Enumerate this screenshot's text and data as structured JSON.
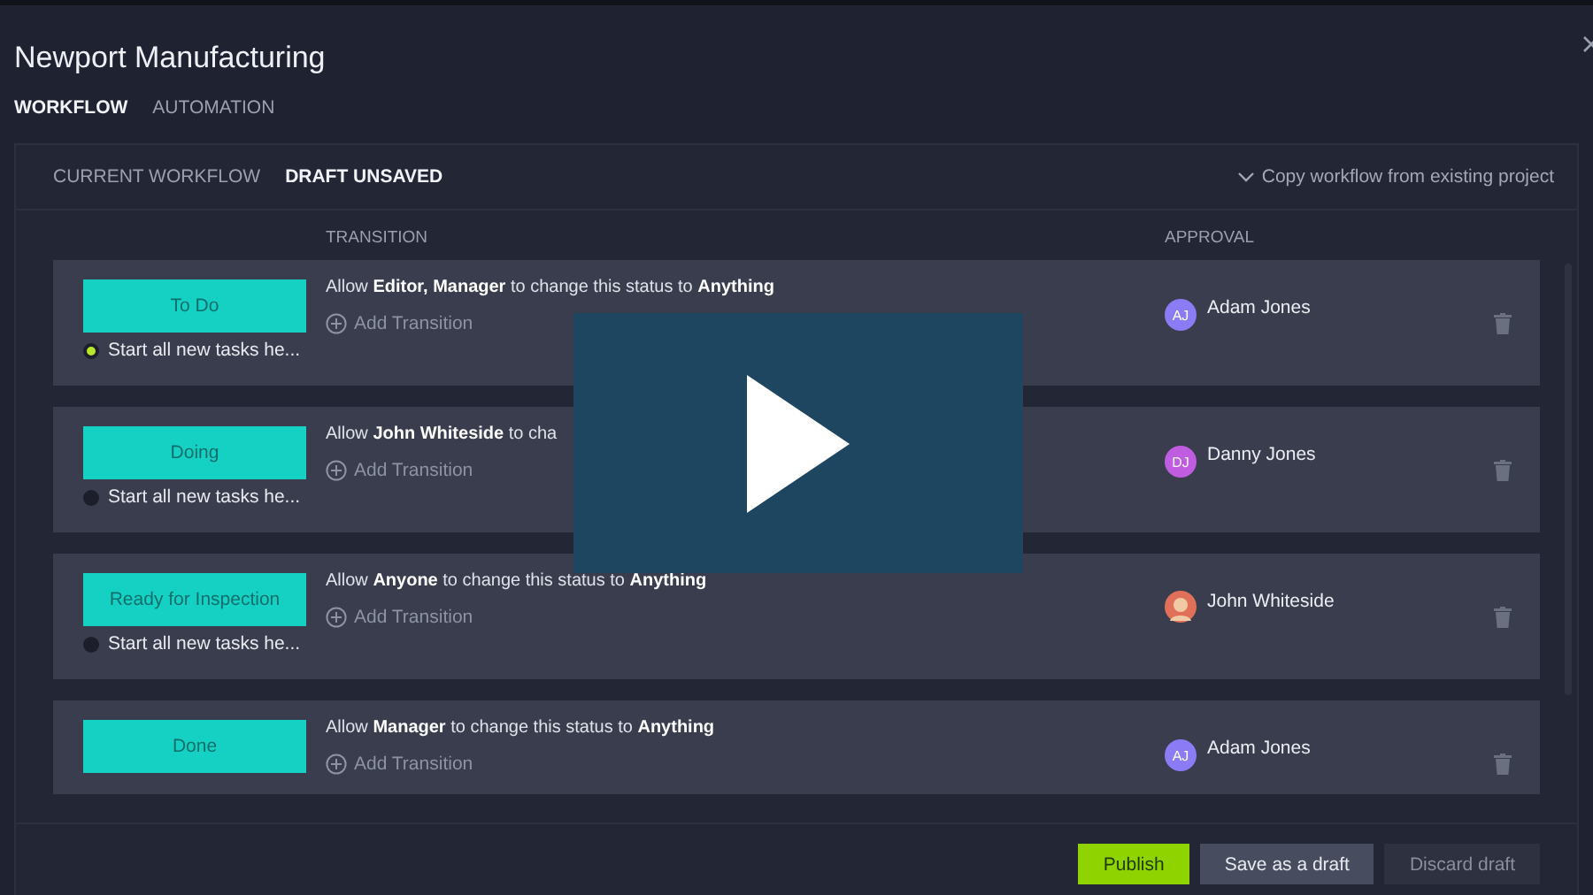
{
  "window": {
    "title": "Newport Manufacturing"
  },
  "tabs": [
    {
      "label": "WORKFLOW",
      "selected": true
    },
    {
      "label": "AUTOMATION",
      "selected": false
    }
  ],
  "subtabs": [
    {
      "label": "CURRENT WORKFLOW",
      "selected": false
    },
    {
      "label": "DRAFT UNSAVED",
      "selected": true
    }
  ],
  "copy_link": "Copy workflow from existing project",
  "columns": {
    "transition": "TRANSITION",
    "approval": "APPROVAL"
  },
  "statuses": [
    {
      "name": "To Do",
      "start_label": "Start all new tasks he...",
      "start_selected": true,
      "transition": "Allow **Editor, Manager** to change this status to **Anything**",
      "add_label": "Add Transition",
      "approver": {
        "name": "Adam Jones",
        "kind": "initials",
        "initials": "AJ",
        "color": "#8b7cf6"
      }
    },
    {
      "name": "Doing",
      "start_label": "Start all new tasks he...",
      "start_selected": false,
      "transition": "Allow **John Whiteside** to cha",
      "add_label": "Add Transition",
      "approver": {
        "name": "Danny Jones",
        "kind": "initials",
        "initials": "DJ",
        "color": "#c05ce0"
      }
    },
    {
      "name": "Ready for Inspection",
      "start_label": "Start all new tasks he...",
      "start_selected": false,
      "transition": "Allow **Anyone** to change this status to **Anything**",
      "add_label": "Add Transition",
      "approver": {
        "name": "John Whiteside",
        "kind": "picture",
        "color": "#e0705a"
      }
    },
    {
      "name": "Done",
      "transition": "Allow **Manager** to change this status to **Anything**",
      "add_label": "Add Transition",
      "approver": {
        "name": "Adam Jones",
        "kind": "initials",
        "initials": "AJ",
        "color": "#8b7cf6"
      }
    }
  ],
  "buttons": [
    {
      "label": "Publish",
      "kind": "primary"
    },
    {
      "label": "Save as a draft",
      "kind": "secondary"
    },
    {
      "label": "Discard draft",
      "kind": "muted"
    }
  ],
  "video_overlay": {
    "shown": true
  }
}
